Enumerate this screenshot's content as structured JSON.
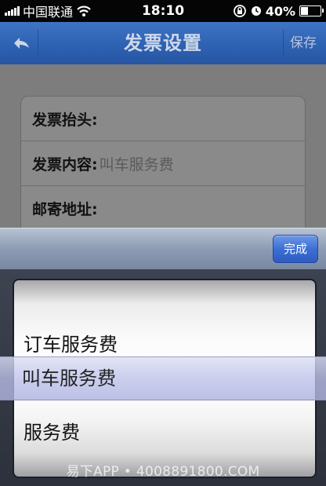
{
  "status_bar": {
    "carrier": "中国联通",
    "time": "18:10",
    "battery_percent": "40%",
    "battery_level": 0.4,
    "icons": [
      "signal-icon",
      "wifi-icon",
      "rotation-lock-icon",
      "alarm-icon",
      "battery-icon"
    ]
  },
  "nav": {
    "back_icon": "back-arrow-icon",
    "title": "发票设置",
    "save_label": "保存"
  },
  "form": {
    "invoice_title_label": "发票抬头:",
    "invoice_content_label": "发票内容:",
    "invoice_content_value": "叫车服务费",
    "mailing_address_label": "邮寄地址:"
  },
  "picker": {
    "done_label": "完成",
    "options": [
      "订车服务费",
      "叫车服务费",
      "服务费"
    ],
    "selected": "叫车服务费"
  },
  "watermark": "易下APP • 4008891800.COM",
  "colors": {
    "nav_blue": "#2f63b4",
    "done_blue": "#3c6fd4"
  }
}
